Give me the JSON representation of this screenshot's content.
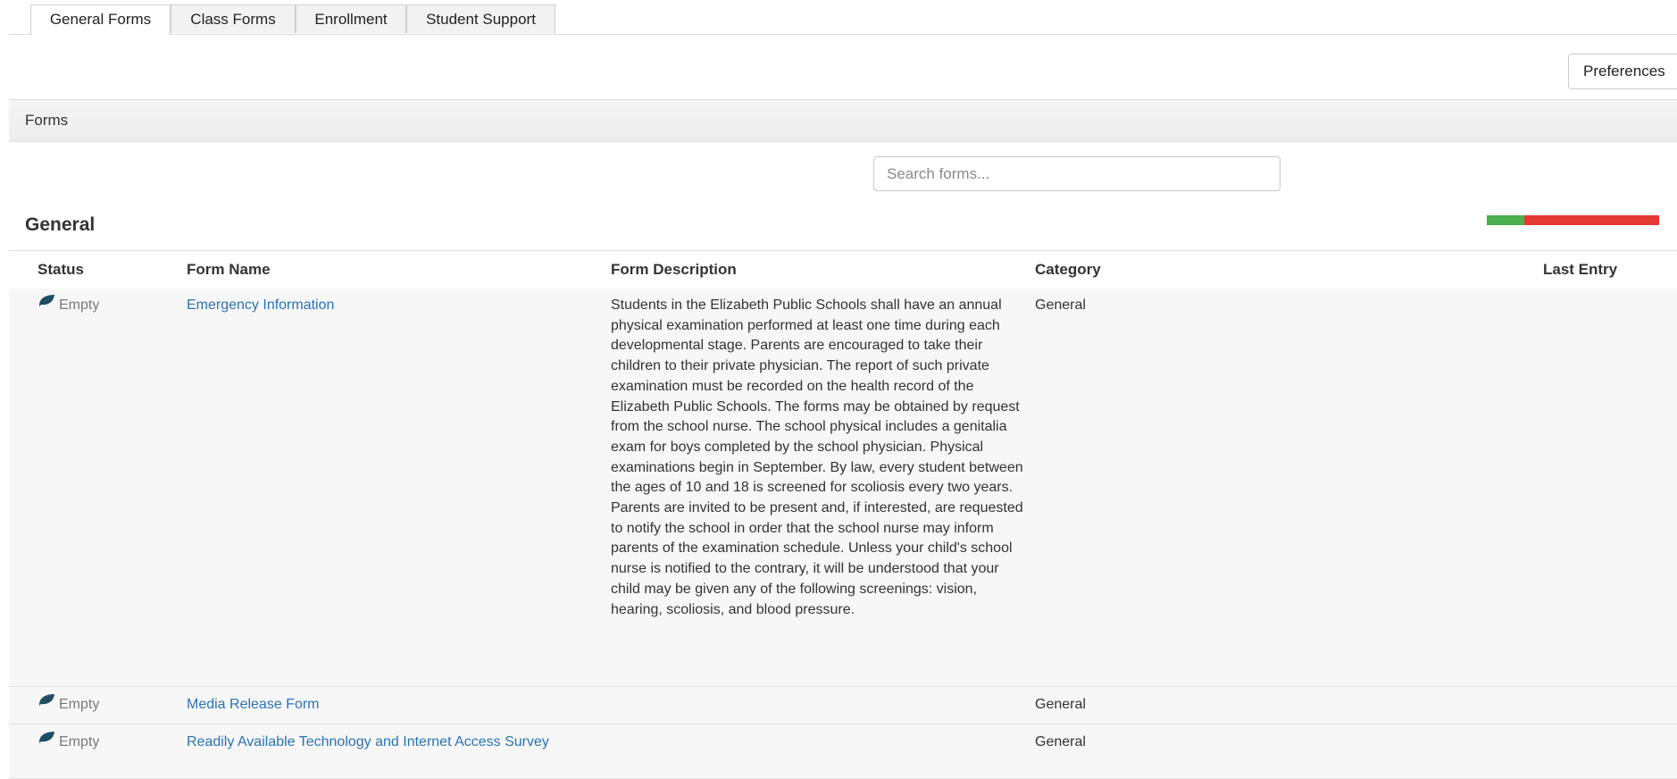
{
  "tabs": [
    {
      "label": "General Forms",
      "active": true
    },
    {
      "label": "Class Forms"
    },
    {
      "label": "Enrollment"
    },
    {
      "label": "Student Support"
    }
  ],
  "preferences_label": "Preferences",
  "forms_bar_label": "Forms",
  "search": {
    "placeholder": "Search forms..."
  },
  "section": {
    "title": "General",
    "progress_fraction_complete": 0.22,
    "colors": {
      "complete": "#4caf50",
      "incomplete": "#e53935"
    }
  },
  "table": {
    "headers": {
      "status": "Status",
      "form_name": "Form Name",
      "form_description": "Form Description",
      "category": "Category",
      "last_entry": "Last Entry"
    },
    "rows": [
      {
        "status": "Empty",
        "status_icon": "leaf-icon",
        "form_name": "Emergency Information",
        "description": "Students in the Elizabeth Public Schools shall have an annual physical examination performed at least one time during each developmental stage. Parents are encouraged to take their children to their private physician. The report of such private examination must be recorded on the health record of the Elizabeth Public Schools. The forms may be obtained by request from the school nurse. The school physical includes a genitalia exam for boys completed by the school physician. Physical examinations begin in September. By law, every student between the ages of 10 and 18 is screened for scoliosis every two years. Parents are invited to be present and, if interested, are requested to notify the school in order that the school nurse may inform parents of the examination schedule. Unless your child's school nurse is notified to the contrary, it will be understood that your child may be given any of the following screenings: vision, hearing, scoliosis, and blood pressure.",
        "category": "General",
        "last_entry": ""
      },
      {
        "status": "Empty",
        "status_icon": "leaf-icon",
        "form_name": "Media Release Form",
        "description": "",
        "category": "General",
        "last_entry": ""
      },
      {
        "status": "Empty",
        "status_icon": "leaf-icon",
        "form_name": "Readily Available Technology and Internet Access Survey",
        "description": "",
        "category": "General",
        "last_entry": ""
      }
    ]
  },
  "colors": {
    "link": "#2a72b5",
    "leaf_icon": "#1f4e63"
  }
}
